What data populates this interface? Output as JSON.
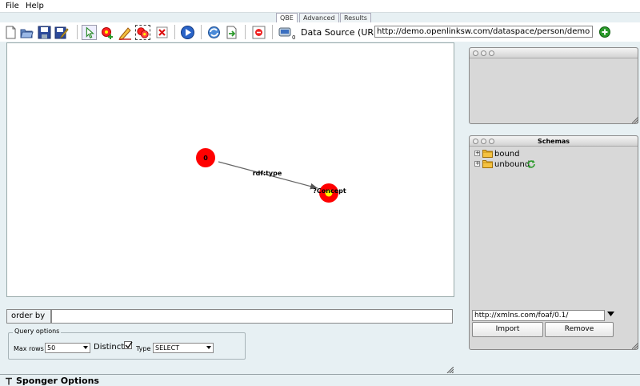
{
  "menu": [
    "File",
    "Help"
  ],
  "tabs": [
    {
      "label": "QBE",
      "active": true
    },
    {
      "label": "Advanced",
      "active": false
    },
    {
      "label": "Results",
      "active": false
    }
  ],
  "toolbar": {
    "icons": [
      "new-file-icon",
      "open-folder-icon",
      "save-icon",
      "save-as-icon",
      "select-pointer-icon",
      "add-node-icon",
      "draw-edge-icon",
      "add-group-icon",
      "delete-icon",
      "run-icon",
      "refresh-icon",
      "export-icon",
      "clear-graph-icon",
      "data-source-icon"
    ],
    "data_source_label": "Data Source (URL):",
    "data_source_url": "http://demo.openlinksw.com/dataspace/person/demo"
  },
  "graph": {
    "nodes": [
      {
        "label": "0",
        "color": "#ff0000"
      },
      {
        "label": "?Concept",
        "color": "#ff0000",
        "center": "#ffff00"
      }
    ],
    "edge_label": "rdf:type"
  },
  "order_by": {
    "button_label": "order by",
    "value": ""
  },
  "query_options": {
    "legend": "Query options",
    "max_rows_label": "Max rows",
    "max_rows_value": "50",
    "distinct_label": "Distinct",
    "distinct_checked": true,
    "type_label": "Type",
    "type_value": "SELECT"
  },
  "schemas": {
    "title": "Schemas",
    "tree": [
      {
        "label": "bound"
      },
      {
        "label": "unbound"
      }
    ],
    "namespace_value": "http://xmlns.com/foaf/0.1/",
    "import_label": "Import",
    "remove_label": "Remove"
  },
  "sponger": {
    "label": "Sponger Options"
  },
  "colors": {
    "background": "#e7f0f3",
    "node": "#ff0000",
    "node_center": "#ffff00",
    "add_button": "#2a9a2a"
  }
}
